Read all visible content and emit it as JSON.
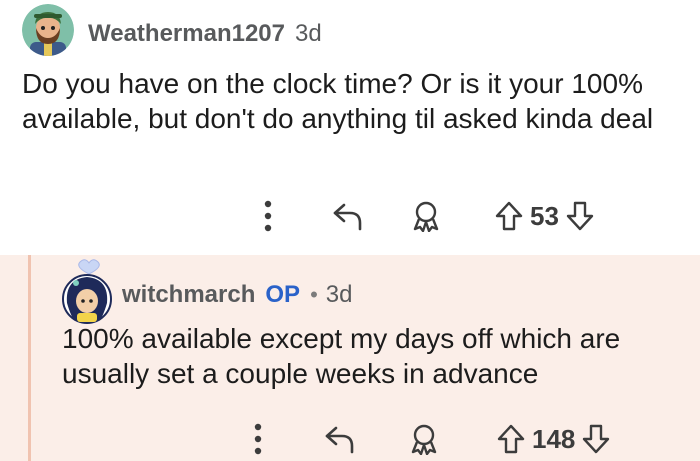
{
  "comments": [
    {
      "username": "Weatherman1207",
      "age": "3d",
      "body": "Do you have on the clock time? Or is it your 100% available, but don't do anything til asked kinda deal",
      "votes": "53",
      "avatar_icon": "bearded-character-avatar-icon"
    },
    {
      "username": "witchmarch",
      "op_badge": "OP",
      "separator": "•",
      "age": "3d",
      "body": "100% available except my days off which are usually set a couple weeks in advance",
      "votes": "148",
      "avatar_icon": "witch-character-avatar-icon",
      "accent_color": "#2a62c9",
      "background_color": "#fbeee8"
    }
  ],
  "icons": {
    "more": "more-options-icon",
    "reply": "reply-icon",
    "award": "award-icon",
    "upvote": "upvote-icon",
    "downvote": "downvote-icon"
  }
}
